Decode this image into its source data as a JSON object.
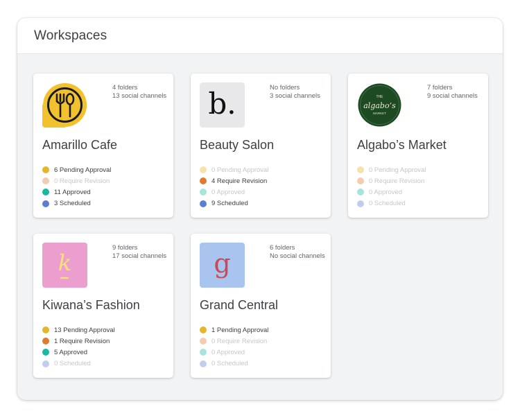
{
  "header": {
    "title": "Workspaces"
  },
  "workspaces": [
    {
      "name": "Amarillo Cafe",
      "logo": "fork-spoon-icon",
      "folders": "4 folders",
      "channels": "13 social channels",
      "stats": [
        {
          "label": "6 Pending Approval",
          "count": 6,
          "color": "#e5b62a"
        },
        {
          "label": "0 Require Revision",
          "count": 0,
          "color": "#e07a32"
        },
        {
          "label": "11 Approved",
          "count": 11,
          "color": "#19b8a0"
        },
        {
          "label": "3 Scheduled",
          "count": 3,
          "color": "#5a7fd1"
        }
      ]
    },
    {
      "name": "Beauty Salon",
      "logo_text": "b.",
      "folders": "No folders",
      "channels": "3 social channels",
      "stats": [
        {
          "label": "0 Pending Approval",
          "count": 0,
          "color": "#e5b62a"
        },
        {
          "label": "4 Require Revision",
          "count": 4,
          "color": "#e07a32"
        },
        {
          "label": "0 Approved",
          "count": 0,
          "color": "#19b8a0"
        },
        {
          "label": "9 Scheduled",
          "count": 9,
          "color": "#5a7fd1"
        }
      ]
    },
    {
      "name": "Algabo’s Market",
      "logo_text": "algabo’s",
      "logo_top": "THE",
      "logo_bottom": "MARKET",
      "folders": "7 folders",
      "channels": "9 social channels",
      "stats": [
        {
          "label": "0 Pending Approval",
          "count": 0,
          "color": "#e5b62a"
        },
        {
          "label": "0 Require Revision",
          "count": 0,
          "color": "#e07a32"
        },
        {
          "label": "0 Approved",
          "count": 0,
          "color": "#19b8a0"
        },
        {
          "label": "0 Scheduled",
          "count": 0,
          "color": "#5a7fd1"
        }
      ]
    },
    {
      "name": "Kiwana’s Fashion",
      "logo_text": "k",
      "folders": "9 folders",
      "channels": "17 social channels",
      "stats": [
        {
          "label": "13 Pending Approval",
          "count": 13,
          "color": "#e5b62a"
        },
        {
          "label": "1 Require Revision",
          "count": 1,
          "color": "#e07a32"
        },
        {
          "label": "5 Approved",
          "count": 5,
          "color": "#19b8a0"
        },
        {
          "label": "0 Scheduled",
          "count": 0,
          "color": "#5a7fd1"
        }
      ]
    },
    {
      "name": "Grand Central",
      "logo_text": "g",
      "folders": "6 folders",
      "channels": "No social channels",
      "stats": [
        {
          "label": "1 Pending Approval",
          "count": 1,
          "color": "#e5b62a"
        },
        {
          "label": "0 Require Revision",
          "count": 0,
          "color": "#e07a32"
        },
        {
          "label": "0 Approved",
          "count": 0,
          "color": "#19b8a0"
        },
        {
          "label": "0 Scheduled",
          "count": 0,
          "color": "#5a7fd1"
        }
      ]
    }
  ]
}
